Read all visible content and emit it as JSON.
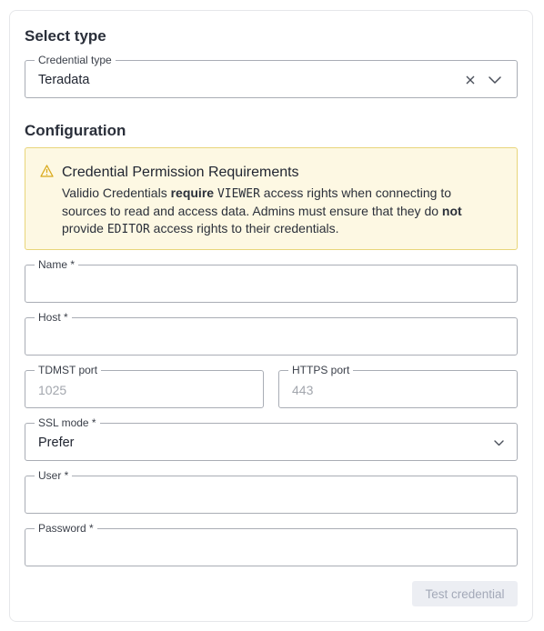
{
  "select_type": {
    "title": "Select type",
    "credential_type": {
      "label": "Credential type",
      "value": "Teradata"
    }
  },
  "configuration": {
    "title": "Configuration",
    "alert": {
      "title": "Credential Permission Requirements",
      "body": {
        "p1": "Validio Credentials ",
        "b1": "require",
        "c1": "VIEWER",
        "p2": " access rights when connecting to sources to read and access data. Admins must ensure that they do ",
        "b2": "not",
        "p3": " provide ",
        "c2": "EDITOR",
        "p4": " access rights to their credentials."
      }
    },
    "fields": {
      "name": {
        "label": "Name *",
        "value": ""
      },
      "host": {
        "label": "Host *",
        "value": ""
      },
      "tdmst_port": {
        "label": "TDMST port",
        "placeholder": "1025"
      },
      "https_port": {
        "label": "HTTPS port",
        "placeholder": "443"
      },
      "ssl_mode": {
        "label": "SSL mode *",
        "value": "Prefer"
      },
      "user": {
        "label": "User *",
        "value": ""
      },
      "password": {
        "label": "Password *",
        "value": ""
      }
    },
    "test_button": "Test credential"
  },
  "icons": {
    "clear": "close-icon",
    "dropdown": "chevron-down-icon",
    "warning": "warning-triangle-icon"
  },
  "colors": {
    "alert_bg": "#fdf8e3",
    "alert_border": "#e8d57a",
    "warning_icon": "#d9a91a",
    "disabled_button_bg": "#eceef3",
    "disabled_button_text": "#a3a9b8"
  }
}
